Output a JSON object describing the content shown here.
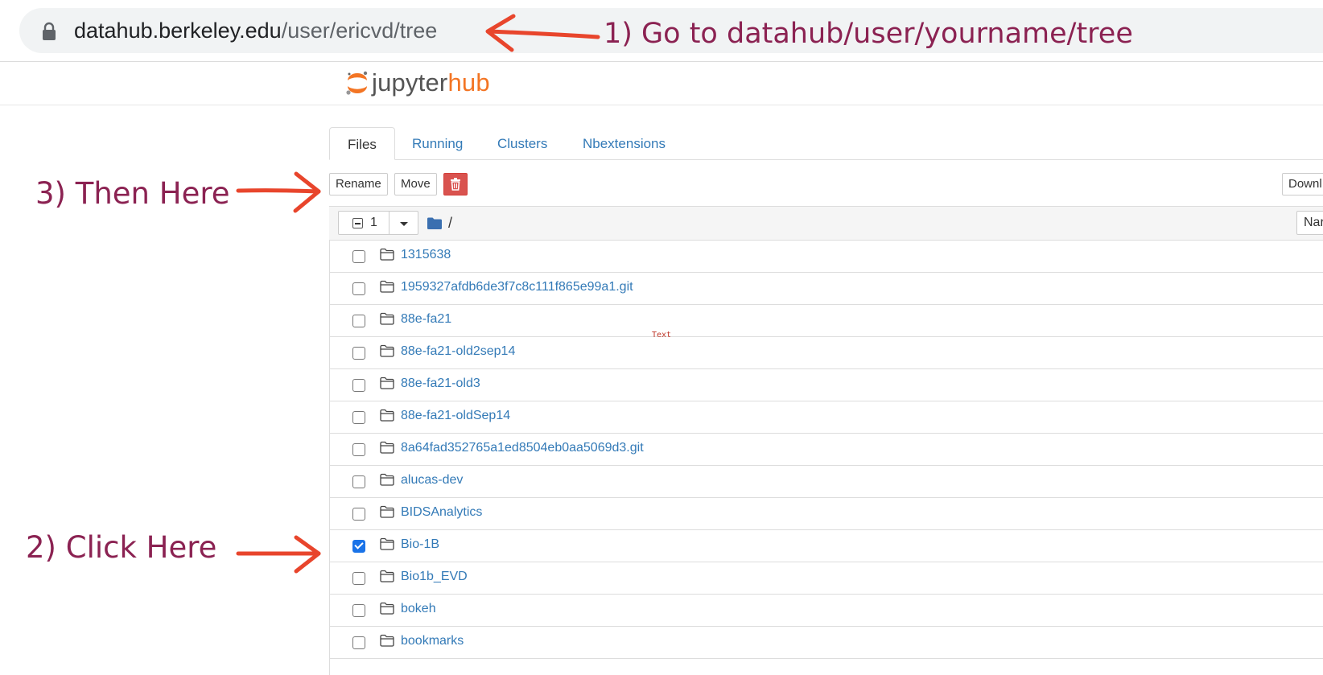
{
  "browser": {
    "url_host": "datahub.berkeley.edu",
    "url_path": "/user/ericvd/tree"
  },
  "header": {
    "logo_part1": "jupyter",
    "logo_part2": "hub"
  },
  "tabs": [
    {
      "label": "Files",
      "active": true
    },
    {
      "label": "Running",
      "active": false
    },
    {
      "label": "Clusters",
      "active": false
    },
    {
      "label": "Nbextensions",
      "active": false
    }
  ],
  "toolbar": {
    "rename_label": "Rename",
    "move_label": "Move",
    "delete_icon": "trash-icon",
    "download_label": "Downl"
  },
  "list_header": {
    "selected_count": "1",
    "breadcrumb": "/",
    "sort_label": "Nar"
  },
  "files": [
    {
      "name": "1315638",
      "checked": false
    },
    {
      "name": "1959327afdb6de3f7c8c111f865e99a1.git",
      "checked": false
    },
    {
      "name": "88e-fa21",
      "checked": false
    },
    {
      "name": "88e-fa21-old2sep14",
      "checked": false
    },
    {
      "name": "88e-fa21-old3",
      "checked": false
    },
    {
      "name": "88e-fa21-oldSep14",
      "checked": false
    },
    {
      "name": "8a64fad352765a1ed8504eb0aa5069d3.git",
      "checked": false
    },
    {
      "name": "alucas-dev",
      "checked": false
    },
    {
      "name": "BIDSAnalytics",
      "checked": false
    },
    {
      "name": "Bio-1B",
      "checked": true
    },
    {
      "name": "Bio1b_EVD",
      "checked": false
    },
    {
      "name": "bokeh",
      "checked": false
    },
    {
      "name": "bookmarks",
      "checked": false
    }
  ],
  "stray_text": "Text",
  "annotations": {
    "step1": "1) Go to datahub/user/yourname/tree",
    "step2": "2) Click Here",
    "step3": "3) Then Here",
    "color": "#8b2252",
    "arrow_color": "#e8452c"
  },
  "colors": {
    "link": "#337ab7",
    "brand_orange": "#f37524",
    "danger": "#d9534f",
    "checkbox_checked": "#1a73e8"
  }
}
